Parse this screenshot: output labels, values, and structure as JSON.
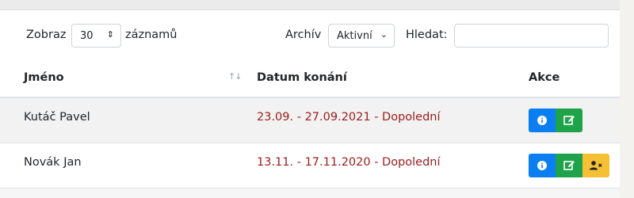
{
  "controls": {
    "show_label": "Zobraz",
    "show_value": "30",
    "records_label": "záznamů",
    "archive_label": "Archív",
    "archive_value": "Aktivní",
    "search_label": "Hledat:",
    "search_value": ""
  },
  "table": {
    "headers": {
      "name": "Jméno",
      "date": "Datum konání",
      "actions": "Akce"
    },
    "rows": [
      {
        "name": "Kutáč Pavel",
        "date": "23.09. - 27.09.2021 - Dopolední"
      },
      {
        "name": "Novák Jan",
        "date": "13.11. - 17.11.2020 - Dopolední"
      }
    ]
  },
  "colors": {
    "info": "#0b7ef2",
    "edit": "#1ea34a",
    "warn": "#f5c034",
    "date": "#9b1c1c"
  },
  "icons": [
    "info-icon",
    "edit-icon",
    "user-remove-icon",
    "sort-icon",
    "dropdown-arrow-icon"
  ]
}
